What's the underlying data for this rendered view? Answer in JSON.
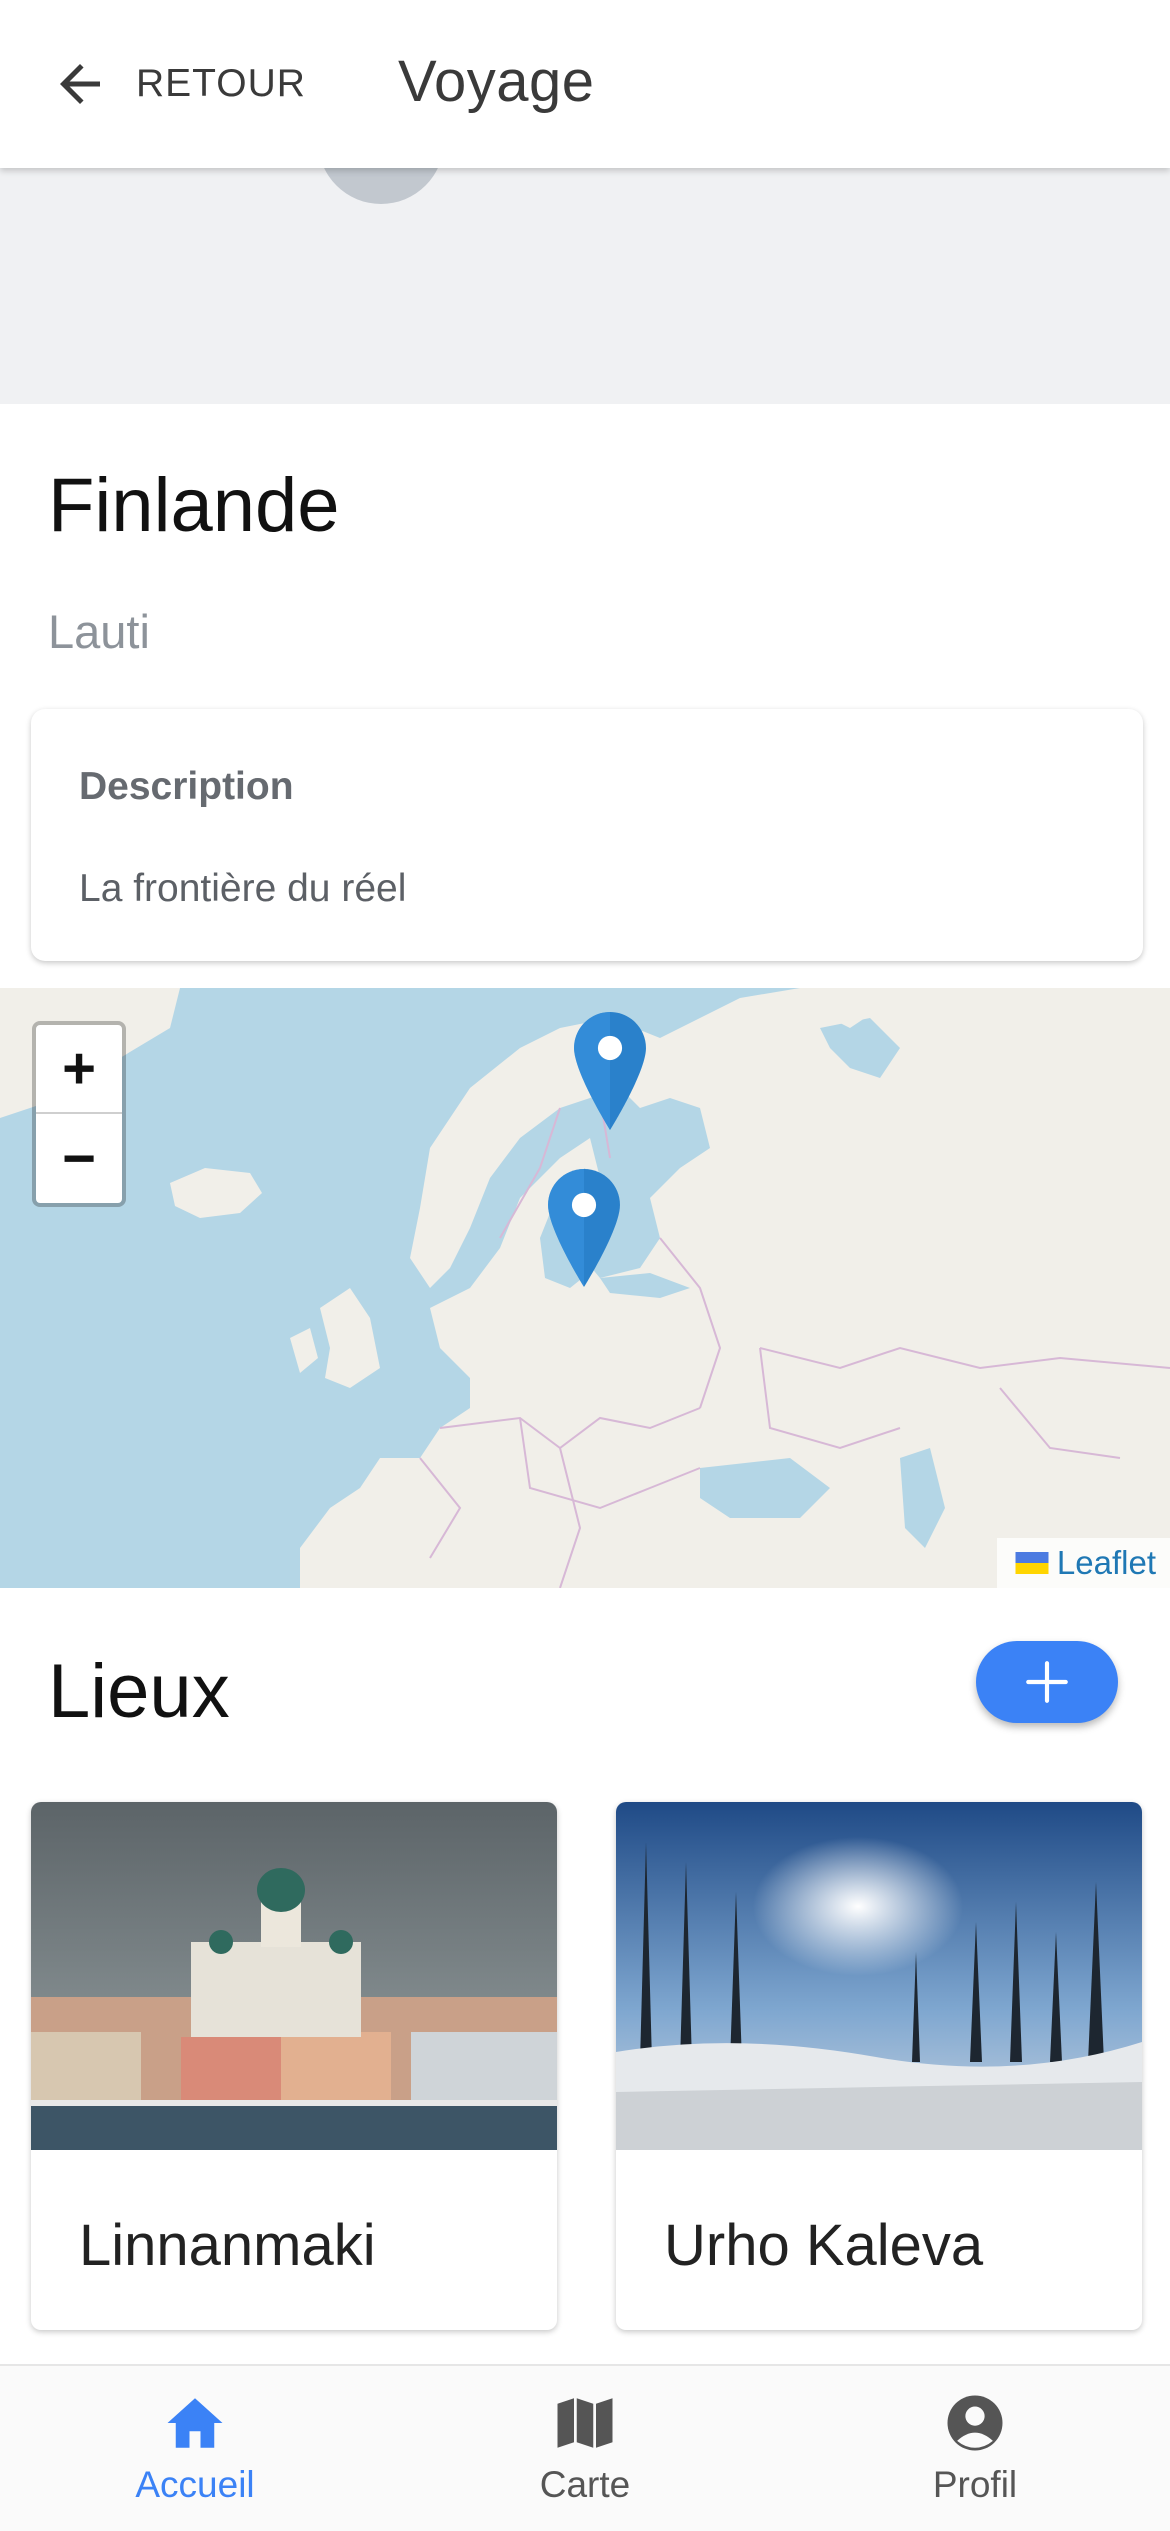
{
  "header": {
    "back_label": "RETOUR",
    "title": "Voyage"
  },
  "trip": {
    "title": "Finlande",
    "owner": "Lauti"
  },
  "description": {
    "heading": "Description",
    "text": "La frontière du réel"
  },
  "map": {
    "zoom_in": "+",
    "zoom_out": "−",
    "attribution": "Leaflet",
    "markers": [
      "marker-lapland",
      "marker-helsinki"
    ]
  },
  "places": {
    "heading": "Lieux",
    "items": [
      {
        "name": "Linnanmaki"
      },
      {
        "name": "Urho Kaleva"
      }
    ]
  },
  "bottom_nav": {
    "items": [
      {
        "label": "Accueil",
        "icon": "home-icon",
        "active": true
      },
      {
        "label": "Carte",
        "icon": "map-icon",
        "active": false
      },
      {
        "label": "Profil",
        "icon": "profile-icon",
        "active": false
      }
    ]
  },
  "colors": {
    "accent": "#3b82f6",
    "marker": "#2a81cb",
    "sea": "#b4d6e6",
    "land": "#f1efe9"
  }
}
